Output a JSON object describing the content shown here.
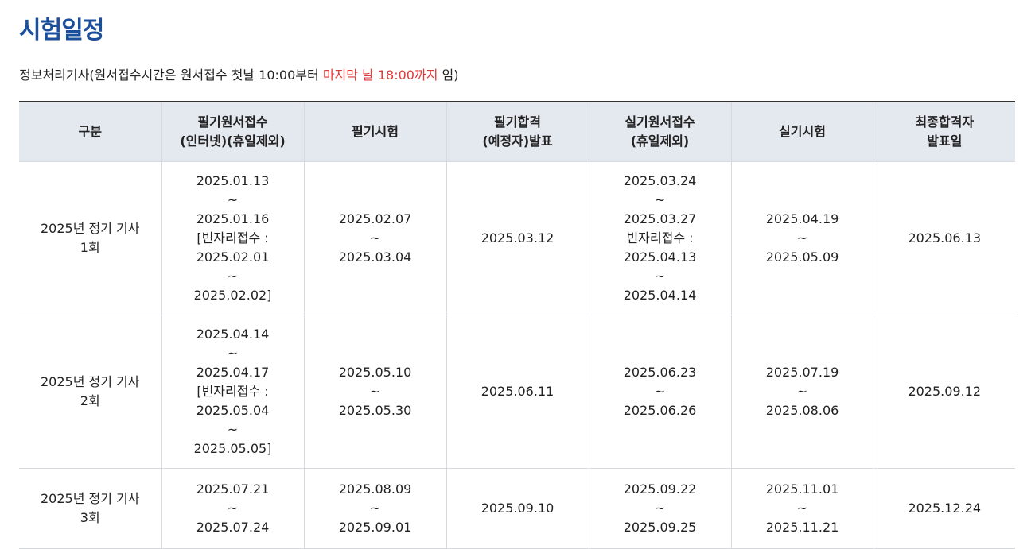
{
  "page": {
    "title": "시험일정",
    "subtitle_prefix": "정보처리기사(원서접수시간은 원서접수 첫날 10:00부터 ",
    "subtitle_highlight": "마지막 날 18:00까지",
    "subtitle_suffix": " 임)",
    "accent_color": "#e03a3a",
    "title_color": "#1b4e9b"
  },
  "table": {
    "headers": [
      [
        "구분"
      ],
      [
        "필기원서접수",
        "(인터넷)(휴일제외)"
      ],
      [
        "필기시험"
      ],
      [
        "필기합격",
        "(예정자)발표"
      ],
      [
        "실기원서접수",
        "(휴일제외)"
      ],
      [
        "실기시험"
      ],
      [
        "최종합격자",
        "발표일"
      ]
    ],
    "rows": [
      [
        [
          "2025년 정기 기사",
          "1회"
        ],
        [
          "2025.01.13",
          "~",
          "2025.01.16",
          "[빈자리접수 :",
          "2025.02.01",
          "~",
          "2025.02.02]"
        ],
        [
          "2025.02.07",
          "~",
          "2025.03.04"
        ],
        [
          "2025.03.12"
        ],
        [
          "2025.03.24",
          "~",
          "2025.03.27",
          "빈자리접수 :",
          "2025.04.13",
          "~",
          "2025.04.14"
        ],
        [
          "2025.04.19",
          "~",
          "2025.05.09"
        ],
        [
          "2025.06.13"
        ]
      ],
      [
        [
          "2025년 정기 기사",
          "2회"
        ],
        [
          "2025.04.14",
          "~",
          "2025.04.17",
          "[빈자리접수 :",
          "2025.05.04",
          "~",
          "2025.05.05]"
        ],
        [
          "2025.05.10",
          "~",
          "2025.05.30"
        ],
        [
          "2025.06.11"
        ],
        [
          "2025.06.23",
          "~",
          "2025.06.26"
        ],
        [
          "2025.07.19",
          "~",
          "2025.08.06"
        ],
        [
          "2025.09.12"
        ]
      ],
      [
        [
          "2025년 정기 기사",
          "3회"
        ],
        [
          "2025.07.21",
          "~",
          "2025.07.24"
        ],
        [
          "2025.08.09",
          "~",
          "2025.09.01"
        ],
        [
          "2025.09.10"
        ],
        [
          "2025.09.22",
          "~",
          "2025.09.25"
        ],
        [
          "2025.11.01",
          "~",
          "2025.11.21"
        ],
        [
          "2025.12.24"
        ]
      ]
    ]
  }
}
